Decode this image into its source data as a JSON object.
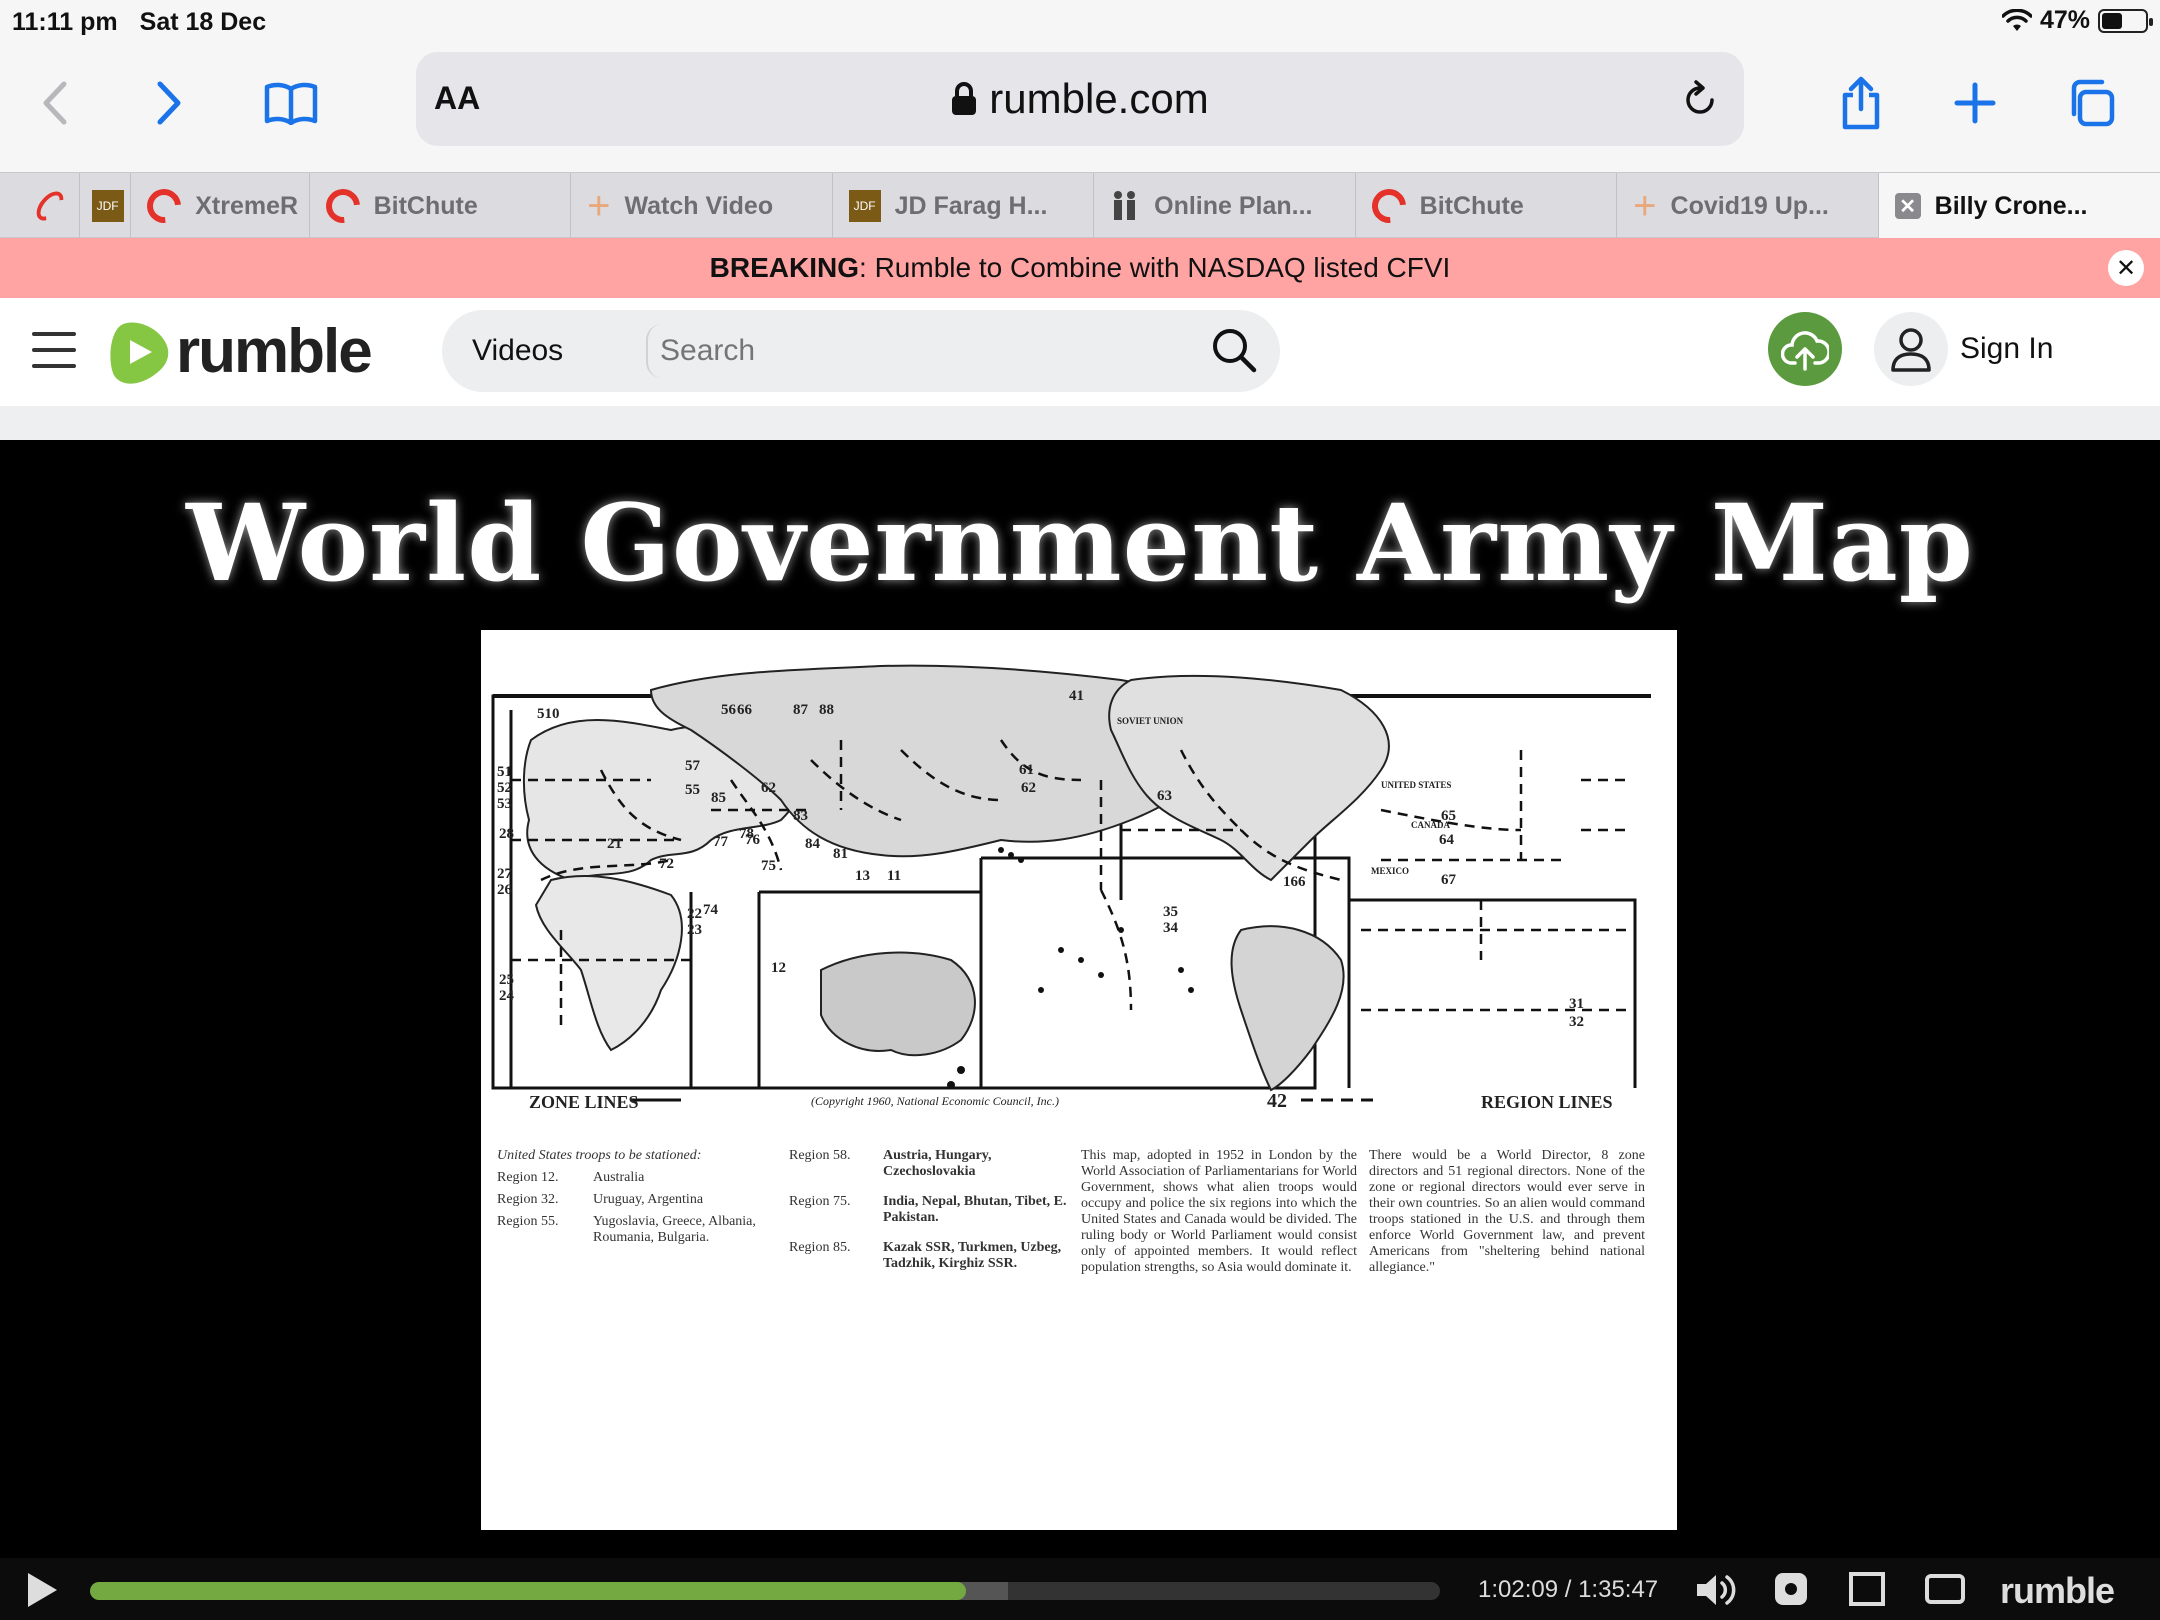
{
  "status": {
    "time": "11:11 pm",
    "date": "Sat 18 Dec",
    "battery_text": "47%",
    "battery_level": 0.47
  },
  "browser": {
    "text_size_label": "AA",
    "domain": "rumble.com"
  },
  "tabs": [
    {
      "label": "",
      "favicon": "rumble-icon"
    },
    {
      "label": "",
      "favicon": "jdf-icon"
    },
    {
      "label": "XtremeR",
      "favicon": "rumble-icon"
    },
    {
      "label": "BitChute",
      "favicon": "rumble-icon"
    },
    {
      "label": "Watch Video",
      "favicon": "plus-icon"
    },
    {
      "label": "JD Farag H...",
      "favicon": "jdf-icon"
    },
    {
      "label": "Online Plan...",
      "favicon": "people-icon"
    },
    {
      "label": "BitChute",
      "favicon": "rumble-icon"
    },
    {
      "label": "Covid19 Up...",
      "favicon": "plus-icon"
    },
    {
      "label": "Billy Crone...",
      "favicon": "close-icon",
      "active": true
    }
  ],
  "breaking": {
    "prefix": "BREAKING",
    "text": ": Rumble to Combine with NASDAQ listed CFVI"
  },
  "site": {
    "brand": "rumble",
    "search_category": "Videos",
    "search_placeholder": "Search",
    "sign_in": "Sign In",
    "accent": "#5b9a3e"
  },
  "video": {
    "title": "World Government Army Map",
    "map": {
      "legend_left": "ZONE LINES",
      "legend_right": "REGION LINES",
      "copyright": "(Copyright 1960, National Economic Council, Inc.)",
      "center_number": "42",
      "region_numbers": [
        "510",
        "51",
        "52",
        "53",
        "28",
        "27",
        "26",
        "25",
        "24",
        "21",
        "22",
        "23",
        "74",
        "72",
        "77",
        "76",
        "75",
        "78",
        "57",
        "55",
        "56",
        "66",
        "87",
        "88",
        "85",
        "62",
        "83",
        "84",
        "81",
        "13",
        "11",
        "12",
        "61",
        "62",
        "41",
        "63",
        "65",
        "64",
        "67",
        "166",
        "35",
        "34",
        "31",
        "32"
      ],
      "labels": [
        "UNITED STATES",
        "CANADA",
        "MEXICO",
        "SOVIET UNION"
      ],
      "col1": {
        "heading": "United States troops to be stationed:",
        "rows": [
          {
            "region": "Region 12.",
            "place": "Australia"
          },
          {
            "region": "Region 32.",
            "place": "Uruguay, Argentina"
          },
          {
            "region": "Region 55.",
            "place": "Yugoslavia, Greece, Albania, Roumania, Bulgaria."
          }
        ]
      },
      "col2": {
        "rows": [
          {
            "region": "Region 58.",
            "place": "Austria, Hungary, Czechoslovakia"
          },
          {
            "region": "Region 75.",
            "place": "India, Nepal, Bhutan, Tibet, E. Pakistan."
          },
          {
            "region": "Region 85.",
            "place": "Kazak SSR, Turkmen, Uzbeg, Tadzhik, Kirghiz SSR."
          }
        ]
      },
      "col3": "This map, adopted in 1952 in London by the World Association of Parliamentarians for World Government, shows what alien troops would occupy and police the six regions into which the United States and Canada would be divided. The ruling body or World Parliament would consist only of appointed members. It would reflect population strengths, so Asia would dominate it.",
      "col4": "There would be a World Director, 8 zone directors and 51 regional directors. None of the zone or regional directors would ever serve in their own countries. So an alien would command troops stationed in the U.S. and through them enforce World Government law, and prevent Americans from \"sheltering behind national allegiance.\""
    },
    "current_time": "1:02:09",
    "duration": "1:35:47",
    "time_display": "1:02:09 / 1:35:47",
    "progress": 0.649,
    "buffered": 0.68,
    "player_brand": "rumble"
  }
}
